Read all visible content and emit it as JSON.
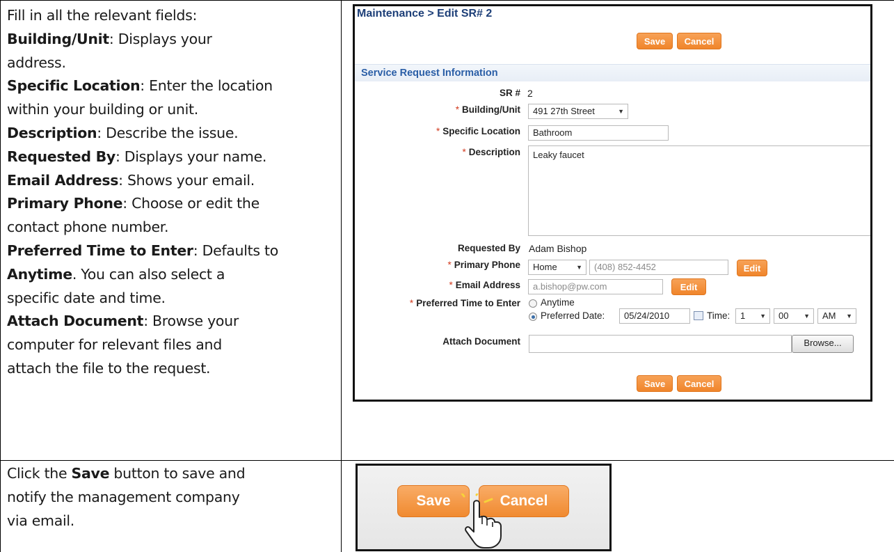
{
  "instructions": {
    "intro": "Fill in all the relevant fields:",
    "items": [
      {
        "term": "Building/Unit",
        "text": "Displays your"
      },
      {
        "term": "",
        "text": "address."
      },
      {
        "term": "Specific Location",
        "text": "Enter the location"
      },
      {
        "term": "",
        "text": "within your building or unit."
      },
      {
        "term": "Description",
        "text": "Describe the issue."
      },
      {
        "term": "Requested By",
        "text": "Displays your name."
      },
      {
        "term": "Email Address",
        "text": "Shows your email."
      },
      {
        "term": "Primary Phone",
        "text": "Choose or edit the"
      },
      {
        "term": "",
        "text": "contact phone number."
      },
      {
        "term": "Preferred Time to Enter",
        "text": "Defaults to"
      }
    ],
    "anytime_term": "Anytime",
    "anytime_text": ". You can also select a",
    "specific_line": "specific date and time.",
    "attach_term": "Attach Document",
    "attach_text": "Browse your",
    "attach_line2": "computer for relevant files and",
    "attach_line3": "attach the file to the request.",
    "save_line1_pre": "Click the",
    "save_term": "Save",
    "save_line1_post": "button to save and",
    "save_line2": "notify the management company",
    "save_line3": "via email."
  },
  "form": {
    "breadcrumb": "Maintenance > Edit SR# 2",
    "save_label": "Save",
    "cancel_label": "Cancel",
    "section_title": "Service Request Information",
    "sr_label": "SR #",
    "sr_value": "2",
    "building_label": "Building/Unit",
    "building_value": "491 27th Street",
    "location_label": "Specific Location",
    "location_value": "Bathroom",
    "description_label": "Description",
    "description_value": "Leaky faucet",
    "requested_label": "Requested By",
    "requested_value": "Adam Bishop",
    "phone_label": "Primary Phone",
    "phone_type": "Home",
    "phone_value": "(408) 852-4452",
    "edit_label": "Edit",
    "email_label": "Email Address",
    "email_value": "a.bishop@pw.com",
    "time_label": "Preferred Time to Enter",
    "anytime_option": "Anytime",
    "preferred_date_option": "Preferred Date:",
    "date_value": "05/24/2010",
    "time_text": "Time:",
    "hour_value": "1",
    "minute_value": "00",
    "ampm_value": "AM",
    "attach_label": "Attach Document",
    "browse_label": "Browse...",
    "required_mark": "*"
  },
  "zoom": {
    "save_label": "Save",
    "cancel_label": "Cancel"
  },
  "colors": {
    "accent_orange": "#f08a30",
    "title_blue": "#1d3f78",
    "section_blue": "#2a5ea6",
    "required_red": "#d23a1e"
  }
}
